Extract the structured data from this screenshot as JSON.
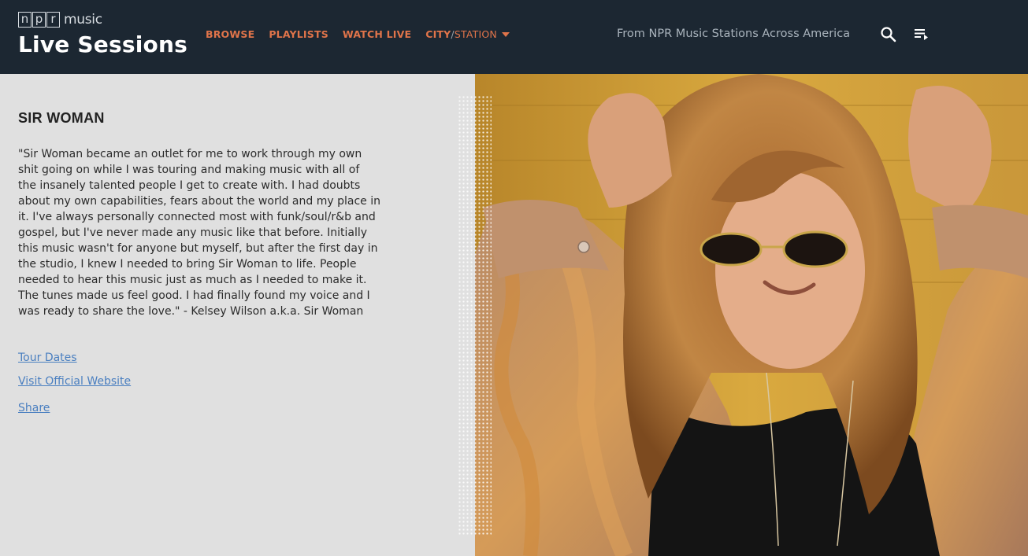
{
  "header": {
    "logo": {
      "npr_letters": [
        "n",
        "p",
        "r"
      ],
      "music": "music",
      "title": "Live Sessions"
    },
    "nav": {
      "browse": "BROWSE",
      "playlists": "PLAYLISTS",
      "watch_live": "WATCH LIVE",
      "city": "CITY",
      "slash": "/",
      "station": "STATION"
    },
    "tagline": "From NPR Music Stations Across America",
    "icons": {
      "search": "search-icon",
      "menu": "playlist-menu-icon"
    }
  },
  "main": {
    "artist_name": "SIR WOMAN",
    "bio": "\"Sir Woman became an outlet for me to work through my own shit going on while I was touring and making music with all of the insanely talented people I get to create with. I had doubts about my own capabilities, fears about the world and my place in it. I've always personally connected most with funk/soul/r&b and gospel, but I've never made any music like that before. Initially this music wasn't for anyone but myself, but after the first day in the studio, I knew I needed to bring Sir Woman to life. People needed to hear this music just as much as I needed to make it. The tunes made us feel good. I had finally found my voice and I was ready to share the love.\" - Kelsey Wilson a.k.a. Sir Woman",
    "links": {
      "tour_dates": "Tour Dates",
      "official_website": "Visit Official Website",
      "share": "Share"
    }
  },
  "colors": {
    "header_bg": "#1c2732",
    "nav_accent": "#e0744a",
    "link": "#4a7fc0",
    "panel_bg": "#e0e0e0"
  }
}
